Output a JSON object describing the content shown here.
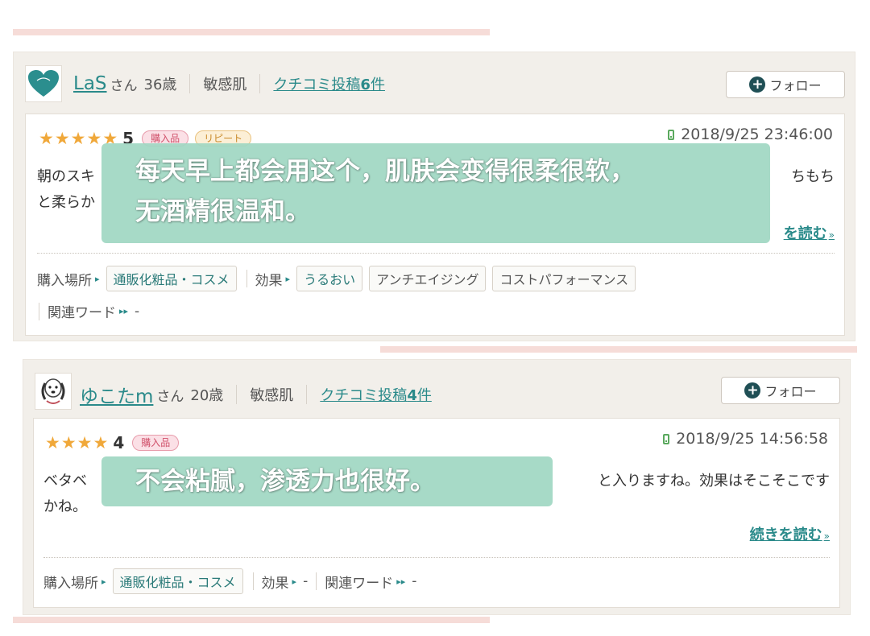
{
  "colors": {
    "accent_teal": "#2a8a8a",
    "star_orange": "#f0a83a",
    "badge_pink": "#d0506a",
    "overlay_mint": "#a0d7c3",
    "card_bg": "#f2efea"
  },
  "follow_label": "フォロー",
  "read_more_label": "続きを読む",
  "review1": {
    "user_name": "LaS",
    "user_suffix": "さん",
    "age": "36歳",
    "skin": "敏感肌",
    "posts_prefix": "クチコミ投稿",
    "posts_count": "6",
    "posts_suffix": "件",
    "rating": "5",
    "stars": 5,
    "badges": [
      "購入品",
      "リピート"
    ],
    "date": "2018/9/25 23:46:00",
    "text_line1_left": "朝のスキ",
    "text_line1_right": "ちもち",
    "text_line2_left": "と柔らか",
    "read_more_visible": "を読む",
    "place_label": "購入場所",
    "place_tag": "通販化粧品・コスメ",
    "effect_label": "効果",
    "effect_tags": [
      "うるおい",
      "アンチエイジング",
      "コストパフォーマンス"
    ],
    "keyword_label": "関連ワード",
    "keyword_value": "-",
    "overlay_line1": "每天早上都会用这个，肌肤会变得很柔很软，",
    "overlay_line2": "无酒精很温和。"
  },
  "review2": {
    "user_name": "ゆこたm",
    "user_suffix": "さん",
    "age": "20歳",
    "skin": "敏感肌",
    "posts_prefix": "クチコミ投稿",
    "posts_count": "4",
    "posts_suffix": "件",
    "rating": "4",
    "stars": 4,
    "badges": [
      "購入品"
    ],
    "date": "2018/9/25 14:56:58",
    "text_line1_left": "ベタベ",
    "text_line1_right": "と入りますね。効果はそこそこです",
    "text_line2_left": "かね。",
    "place_label": "購入場所",
    "place_tag": "通販化粧品・コスメ",
    "effect_label": "効果",
    "effect_value": "-",
    "keyword_label": "関連ワード",
    "keyword_value": "-",
    "overlay_line1": "不会粘腻，渗透力也很好。"
  }
}
